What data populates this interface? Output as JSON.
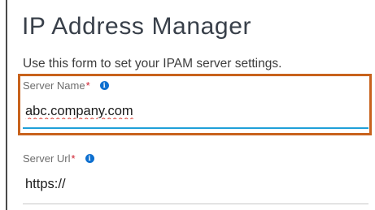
{
  "page": {
    "title": "IP Address Manager",
    "description": "Use this form to set your IPAM server settings."
  },
  "form": {
    "server_name": {
      "label": "Server Name",
      "required_mark": "*",
      "info_icon": "i",
      "value": "abc.company.com"
    },
    "server_url": {
      "label": "Server Url",
      "required_mark": "*",
      "info_icon": "i",
      "value": "https://"
    }
  },
  "icons": {
    "info": "info-icon"
  },
  "colors": {
    "highlight_border": "#c8621c",
    "active_underline": "#1fa0d8",
    "info_icon": "#0d6fcf",
    "required": "#cf2030"
  }
}
